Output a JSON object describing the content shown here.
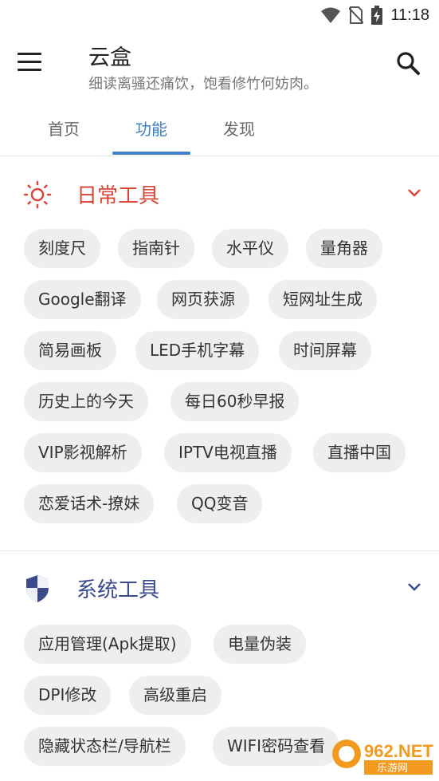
{
  "status": {
    "time": "11:18"
  },
  "app": {
    "title": "云盒",
    "subtitle": "细读离骚还痛饮，饱看修竹何妨肉。"
  },
  "tabs": [
    {
      "label": "首页",
      "active": false
    },
    {
      "label": "功能",
      "active": true
    },
    {
      "label": "发现",
      "active": false
    }
  ],
  "sections": [
    {
      "title": "日常工具",
      "color": "#d9473b",
      "icon": "sun-icon",
      "chips": [
        "刻度尺",
        "指南针",
        "水平仪",
        "量角器",
        "Google翻译",
        "网页获源",
        "短网址生成",
        "简易画板",
        "LED手机字幕",
        "时间屏幕",
        "历史上的今天",
        "每日60秒早报",
        "VIP影视解析",
        "IPTV电视直播",
        "直播中国",
        "恋爱话术-撩妹",
        "QQ变音"
      ]
    },
    {
      "title": "系统工具",
      "color": "#3a4a8c",
      "icon": "shield-icon",
      "chips": [
        "应用管理(Apk提取)",
        "电量伪装",
        "DPI修改",
        "高级重启",
        "隐藏状态栏/导航栏",
        "WIFI密码查看"
      ]
    }
  ],
  "colors": {
    "accent": "#3f7fc6",
    "chip_bg": "#eeeeee"
  },
  "watermark": {
    "line1": "962.NET",
    "line2": "乐游网"
  }
}
